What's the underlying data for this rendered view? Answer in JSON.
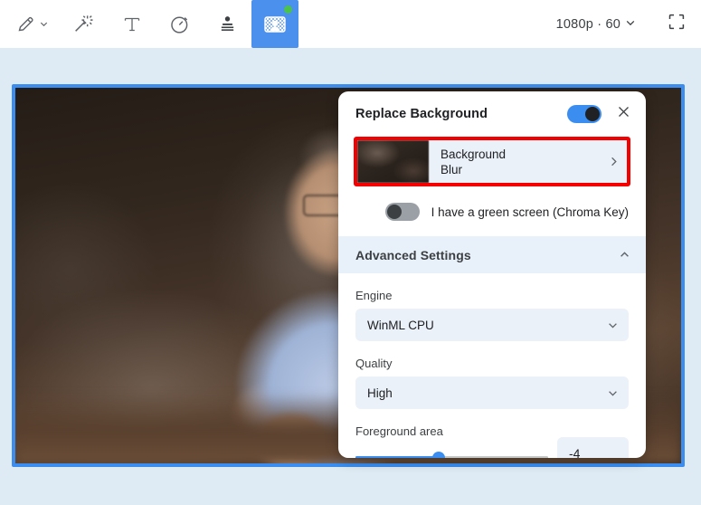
{
  "toolbar": {
    "tools": [
      {
        "name": "pen-tool",
        "icon": "pen-icon",
        "has_dropdown": true,
        "active": false
      },
      {
        "name": "magic-wand-tool",
        "icon": "magic-wand-icon",
        "has_dropdown": false,
        "active": false
      },
      {
        "name": "text-tool",
        "icon": "text-icon",
        "has_dropdown": false,
        "active": false
      },
      {
        "name": "timer-tool",
        "icon": "stopwatch-icon",
        "has_dropdown": false,
        "active": false
      },
      {
        "name": "presenter-tool",
        "icon": "presenter-icon",
        "has_dropdown": false,
        "active": false
      },
      {
        "name": "replace-background-tool",
        "icon": "background-person-icon",
        "has_dropdown": false,
        "active": true
      }
    ],
    "resolution_label": "1080p · 60",
    "resolution_chevron": "chevron-down-icon",
    "fullscreen_icon": "fullscreen-icon",
    "active_tool_badge_color": "#4bc24b",
    "active_tool_bg": "#4a90ec"
  },
  "video": {
    "border_color": "#3b8ef0",
    "description": "Blurred background webcam preview of a man with glasses in a light blue shirt"
  },
  "panel": {
    "title": "Replace Background",
    "enabled_toggle": {
      "name": "replace-background-toggle",
      "state": "on",
      "track_color": "#3b8ef0"
    },
    "close_icon": "close-icon",
    "background_choice": {
      "line1": "Background",
      "line2": "Blur",
      "arrow_icon": "chevron-right-icon",
      "highlight_color": "#f40000",
      "row_bg": "#eaf1f9"
    },
    "chroma_key": {
      "label": "I have a green screen (Chroma Key)",
      "toggle": {
        "name": "chroma-key-toggle",
        "state": "off",
        "track_color": "#9aa0a6"
      }
    },
    "advanced_settings": {
      "title": "Advanced Settings",
      "chevron_icon": "chevron-up-icon",
      "expanded": true,
      "band_bg": "#e8f0f9",
      "engine": {
        "label": "Engine",
        "value": "WinML CPU",
        "chevron_icon": "chevron-down-icon"
      },
      "quality": {
        "label": "Quality",
        "value": "High",
        "chevron_icon": "chevron-down-icon"
      },
      "foreground_area": {
        "label": "Foreground area",
        "value": "-4",
        "slider_percent": 43,
        "slider_fill_color": "#3b8ef0",
        "slider_track_color": "#c4c7c5"
      }
    }
  },
  "page": {
    "background_color": "#deeaf4"
  }
}
